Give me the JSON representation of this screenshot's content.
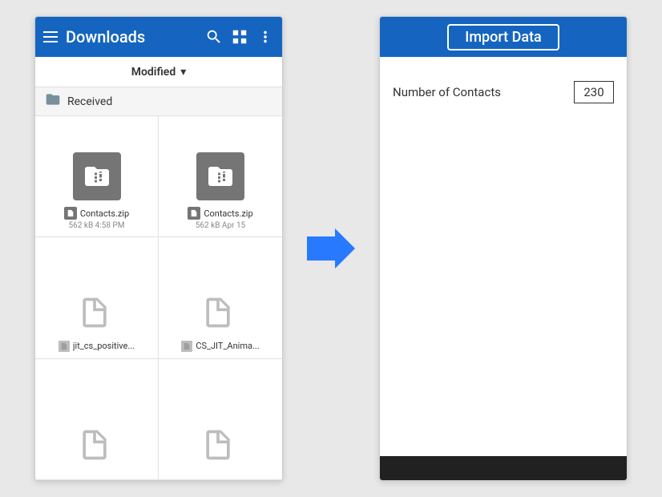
{
  "left_phone": {
    "toolbar": {
      "title": "Downloads",
      "menu_icon": "hamburger-icon",
      "search_icon": "search-icon",
      "grid_icon": "grid-icon",
      "more_icon": "more-vert-icon"
    },
    "sort_bar": {
      "label": "Modified",
      "chevron": "▾"
    },
    "received_folder": {
      "label": "Received"
    },
    "files": [
      {
        "type": "zip",
        "name": "Contacts.zip",
        "info": "562 kB  4:58 PM"
      },
      {
        "type": "zip",
        "name": "Contacts.zip",
        "info": "562 kB  Apr 15"
      },
      {
        "type": "doc",
        "name": "jit_cs_positive...",
        "info": ""
      },
      {
        "type": "doc",
        "name": "CS_JIT_Anima...",
        "info": ""
      },
      {
        "type": "doc",
        "name": "",
        "info": ""
      },
      {
        "type": "doc",
        "name": "",
        "info": ""
      }
    ]
  },
  "right_phone": {
    "header": {
      "title": "Import Data"
    },
    "fields": [
      {
        "label": "Number of Contacts",
        "value": "230"
      }
    ]
  },
  "arrow": {
    "label": "arrow-right"
  }
}
